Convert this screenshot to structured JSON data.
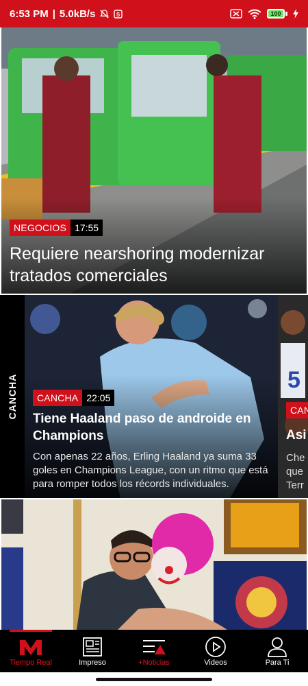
{
  "status_bar": {
    "time": "6:53 PM",
    "speed": "5.0kB/s",
    "battery": "100"
  },
  "story1": {
    "category": "NEGOCIOS",
    "time": "17:55",
    "headline": "Requiere nearshoring modernizar tratados comerciales"
  },
  "section": {
    "label": "CANCHA",
    "cards": [
      {
        "category": "CANCHA",
        "time": "22:05",
        "headline": "Tiene Haaland paso de androide en Champions",
        "summary": "Con apenas 22 años, Erling Haaland ya suma 33 goles en Champions League, con un ritmo que está para romper todos los récords individuales."
      },
      {
        "category": "CAN",
        "headline": "Asi",
        "summary_lines": [
          "Che",
          "que",
          "Terr"
        ]
      }
    ]
  },
  "bottom_nav": [
    {
      "label": "Tiempo Real",
      "icon": "m-logo-icon"
    },
    {
      "label": "Impreso",
      "icon": "newspaper-icon"
    },
    {
      "label": "+Noticias",
      "icon": "more-news-icon"
    },
    {
      "label": "Videos",
      "icon": "play-circle-icon"
    },
    {
      "label": "Para Ti",
      "icon": "user-icon"
    }
  ],
  "colors": {
    "brand_red": "#d0101a",
    "nav_bg": "#000000",
    "tag_time_bg": "#000000"
  }
}
